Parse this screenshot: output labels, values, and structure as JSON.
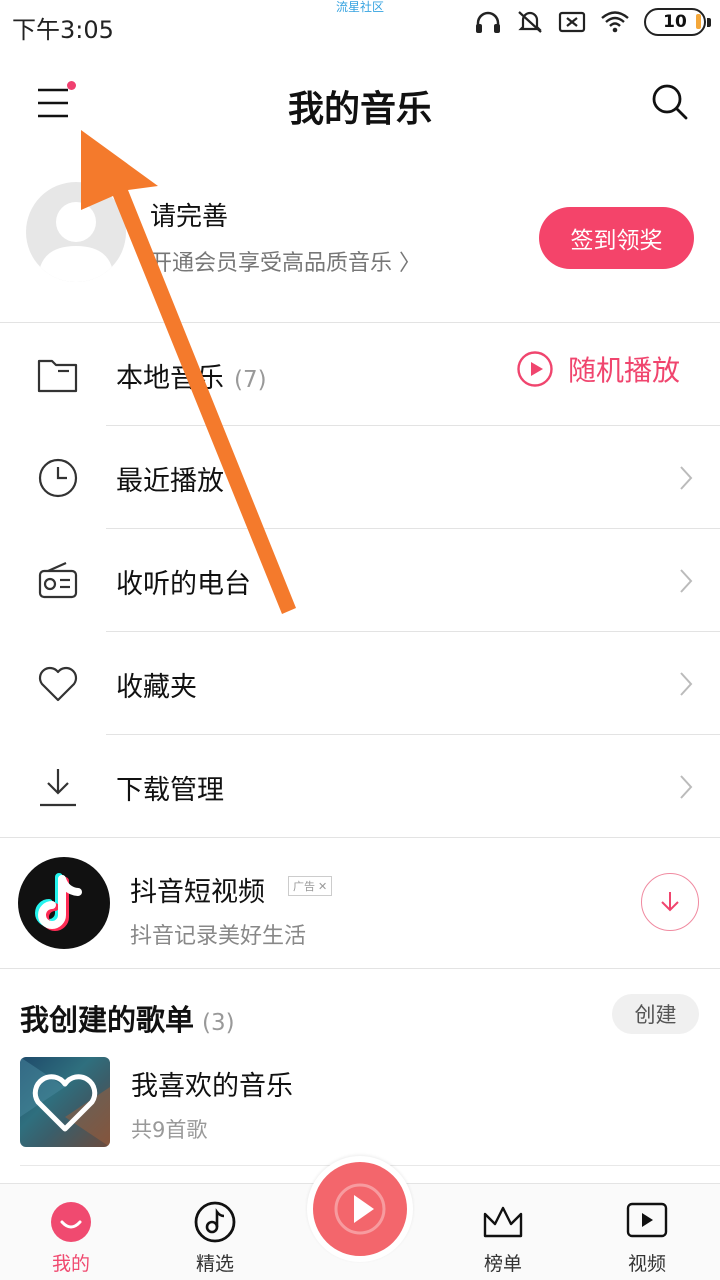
{
  "status_bar": {
    "time": "下午3:05",
    "watermark": "流星社区",
    "battery": "10",
    "icons": [
      "headphones-icon",
      "mute-icon",
      "sim-off-icon",
      "wifi-icon",
      "battery-icon"
    ]
  },
  "header": {
    "title": "我的音乐",
    "menu_icon": "menu-icon",
    "search_icon": "search-icon"
  },
  "profile": {
    "name": "请完善",
    "vip_text": "开通会员享受高品质音乐 〉",
    "checkin_label": "签到领奖"
  },
  "menu": {
    "items": [
      {
        "label": "本地音乐",
        "count": "(7)",
        "icon": "folder-icon"
      },
      {
        "label": "最近播放",
        "icon": "clock-icon"
      },
      {
        "label": "收听的电台",
        "icon": "radio-icon"
      },
      {
        "label": "收藏夹",
        "icon": "heart-icon"
      },
      {
        "label": "下载管理",
        "icon": "download-icon"
      }
    ],
    "shuffle_label": "随机播放"
  },
  "ad": {
    "title": "抖音短视频",
    "tag": "广告",
    "subtitle": "抖音记录美好生活"
  },
  "playlists": {
    "heading": "我创建的歌单",
    "count": "(3)",
    "create_label": "创建",
    "items": [
      {
        "name": "我喜欢的音乐",
        "sub": "共9首歌"
      }
    ]
  },
  "bottom_nav": {
    "items": [
      {
        "label": "我的",
        "icon": "smile-icon",
        "active": true
      },
      {
        "label": "精选",
        "icon": "music-disc-icon"
      },
      {
        "label": "榜单",
        "icon": "crown-icon"
      },
      {
        "label": "视频",
        "icon": "video-icon"
      }
    ]
  },
  "colors": {
    "accent": "#f4446a",
    "annotation": "#f47a2c"
  }
}
